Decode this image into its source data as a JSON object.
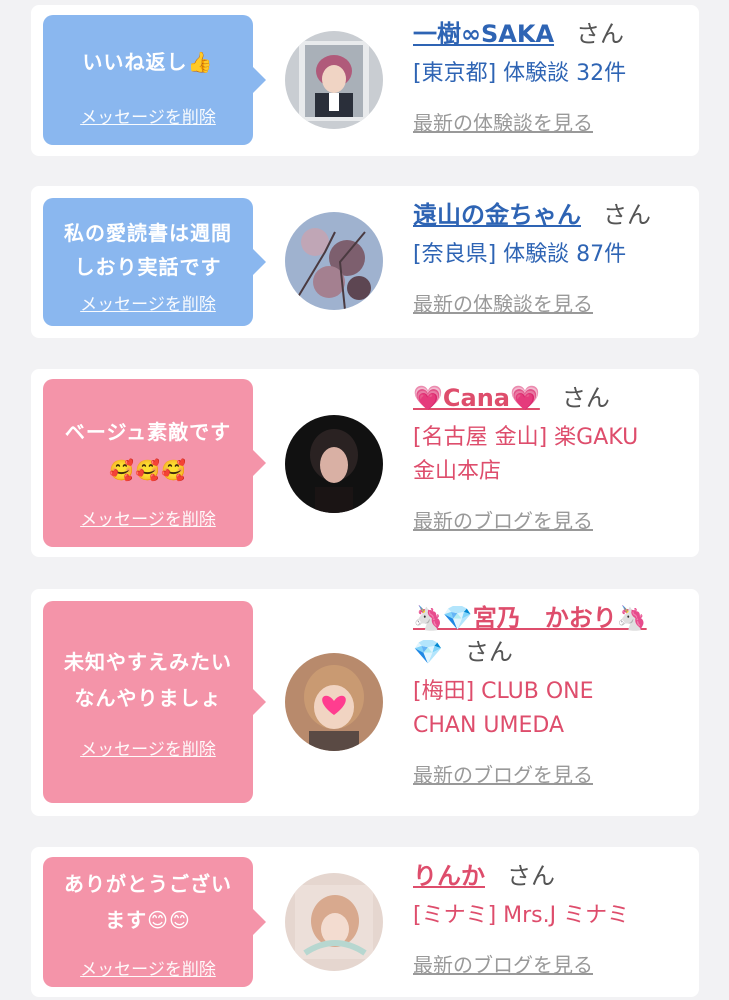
{
  "cards": [
    {
      "message": "いいね返し👍",
      "delete_label": "メッセージを削除",
      "name": "一樹∞SAKA",
      "honorific": "さん",
      "detail": "[東京都] 体験談 32件",
      "latest": "最新の体験談を見る",
      "theme": "blue"
    },
    {
      "message_line1": "私の愛読書は週間",
      "message_line2": "しおり実話です",
      "delete_label": "メッセージを削除",
      "name": "遠山の金ちゃん",
      "honorific": "さん",
      "detail": "[奈良県] 体験談 87件",
      "latest": "最新の体験談を見る",
      "theme": "blue"
    },
    {
      "message_line1": "ベージュ素敵です",
      "message_line2": "🥰🥰🥰",
      "delete_label": "メッセージを削除",
      "name": "💗Cana💗",
      "honorific": "さん",
      "detail_line1": "[名古屋 金山] 楽GAKU",
      "detail_line2": "金山本店",
      "latest": "最新のブログを見る",
      "theme": "pink"
    },
    {
      "message_line1": "未知やすえみたい",
      "message_line2": "なんやりましょ",
      "delete_label": "メッセージを削除",
      "name_line1": "🦄💎宮乃　かおり🦄",
      "name_line2": "💎",
      "honorific": "さん",
      "detail_line1": "[梅田] CLUB ONE",
      "detail_line2": "CHAN UMEDA",
      "latest": "最新のブログを見る",
      "theme": "pink"
    },
    {
      "message_line1": "ありがとうござい",
      "message_line2": "ます😊😊",
      "delete_label": "メッセージを削除",
      "name": "りんか",
      "honorific": "さん",
      "detail": "[ミナミ] Mrs.J ミナミ",
      "latest": "最新のブログを見る",
      "theme": "pink"
    }
  ],
  "colors": {
    "blue_bubble": "#8ab7ef",
    "pink_bubble": "#f494a9",
    "blue_text": "#2e64b4",
    "pink_text": "#de4d6c",
    "background": "#f2f2f4"
  }
}
